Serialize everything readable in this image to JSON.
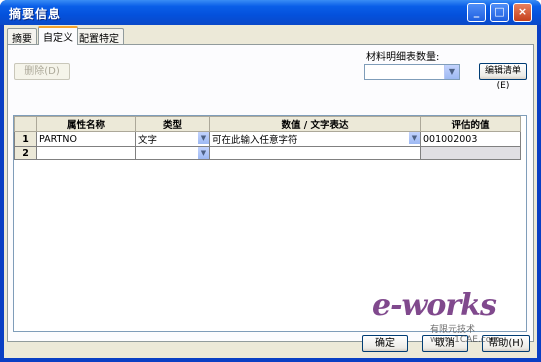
{
  "window": {
    "title": "摘要信息",
    "minimize_glyph": "_",
    "maximize_glyph": "□",
    "close_glyph": "×"
  },
  "tabs": [
    {
      "label": "摘要",
      "active": false
    },
    {
      "label": "自定义",
      "active": true
    },
    {
      "label": "配置特定",
      "active": false
    }
  ],
  "toolbar": {
    "delete_label": "删除(D)",
    "bom_quantity_label": "材料明细表数量:",
    "bom_quantity_value": "",
    "edit_list_label": "编辑清单(E)"
  },
  "grid": {
    "columns": [
      "",
      "属性名称",
      "类型",
      "数值 / 文字表达",
      "评估的值"
    ],
    "rows": [
      {
        "num": "1",
        "name": "PARTNO",
        "type": "文字",
        "expression": "可在此输入任意字符",
        "evaluated": "001002003"
      },
      {
        "num": "2",
        "name": "",
        "type": "",
        "expression": "",
        "evaluated": ""
      }
    ]
  },
  "footer": {
    "ok_label": "确定",
    "cancel_label": "取消",
    "help_label": "帮助(H)"
  },
  "watermark": {
    "brand": "e-works",
    "sub": "有限元技术 www.1CAE.com"
  },
  "icons": {
    "dropdown": "chevron-down-icon"
  },
  "colors": {
    "titlebar": "#0a5fe8",
    "tab_highlight": "#f5a22b",
    "client_bg": "#ece9d8"
  }
}
